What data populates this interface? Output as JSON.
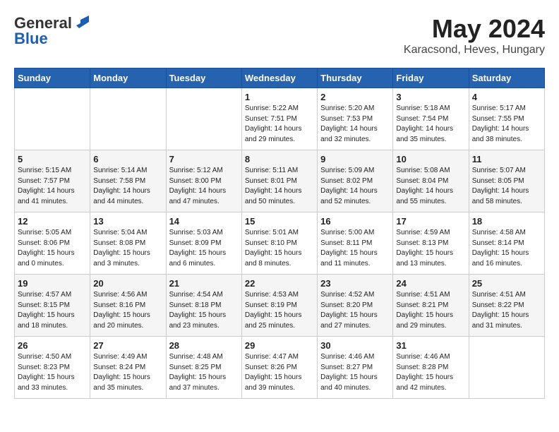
{
  "logo": {
    "line1": "General",
    "line2": "Blue"
  },
  "title": "May 2024",
  "subtitle": "Karacsond, Heves, Hungary",
  "days_of_week": [
    "Sunday",
    "Monday",
    "Tuesday",
    "Wednesday",
    "Thursday",
    "Friday",
    "Saturday"
  ],
  "weeks": [
    [
      {
        "day": "",
        "info": ""
      },
      {
        "day": "",
        "info": ""
      },
      {
        "day": "",
        "info": ""
      },
      {
        "day": "1",
        "info": "Sunrise: 5:22 AM\nSunset: 7:51 PM\nDaylight: 14 hours\nand 29 minutes."
      },
      {
        "day": "2",
        "info": "Sunrise: 5:20 AM\nSunset: 7:53 PM\nDaylight: 14 hours\nand 32 minutes."
      },
      {
        "day": "3",
        "info": "Sunrise: 5:18 AM\nSunset: 7:54 PM\nDaylight: 14 hours\nand 35 minutes."
      },
      {
        "day": "4",
        "info": "Sunrise: 5:17 AM\nSunset: 7:55 PM\nDaylight: 14 hours\nand 38 minutes."
      }
    ],
    [
      {
        "day": "5",
        "info": "Sunrise: 5:15 AM\nSunset: 7:57 PM\nDaylight: 14 hours\nand 41 minutes."
      },
      {
        "day": "6",
        "info": "Sunrise: 5:14 AM\nSunset: 7:58 PM\nDaylight: 14 hours\nand 44 minutes."
      },
      {
        "day": "7",
        "info": "Sunrise: 5:12 AM\nSunset: 8:00 PM\nDaylight: 14 hours\nand 47 minutes."
      },
      {
        "day": "8",
        "info": "Sunrise: 5:11 AM\nSunset: 8:01 PM\nDaylight: 14 hours\nand 50 minutes."
      },
      {
        "day": "9",
        "info": "Sunrise: 5:09 AM\nSunset: 8:02 PM\nDaylight: 14 hours\nand 52 minutes."
      },
      {
        "day": "10",
        "info": "Sunrise: 5:08 AM\nSunset: 8:04 PM\nDaylight: 14 hours\nand 55 minutes."
      },
      {
        "day": "11",
        "info": "Sunrise: 5:07 AM\nSunset: 8:05 PM\nDaylight: 14 hours\nand 58 minutes."
      }
    ],
    [
      {
        "day": "12",
        "info": "Sunrise: 5:05 AM\nSunset: 8:06 PM\nDaylight: 15 hours\nand 0 minutes."
      },
      {
        "day": "13",
        "info": "Sunrise: 5:04 AM\nSunset: 8:08 PM\nDaylight: 15 hours\nand 3 minutes."
      },
      {
        "day": "14",
        "info": "Sunrise: 5:03 AM\nSunset: 8:09 PM\nDaylight: 15 hours\nand 6 minutes."
      },
      {
        "day": "15",
        "info": "Sunrise: 5:01 AM\nSunset: 8:10 PM\nDaylight: 15 hours\nand 8 minutes."
      },
      {
        "day": "16",
        "info": "Sunrise: 5:00 AM\nSunset: 8:11 PM\nDaylight: 15 hours\nand 11 minutes."
      },
      {
        "day": "17",
        "info": "Sunrise: 4:59 AM\nSunset: 8:13 PM\nDaylight: 15 hours\nand 13 minutes."
      },
      {
        "day": "18",
        "info": "Sunrise: 4:58 AM\nSunset: 8:14 PM\nDaylight: 15 hours\nand 16 minutes."
      }
    ],
    [
      {
        "day": "19",
        "info": "Sunrise: 4:57 AM\nSunset: 8:15 PM\nDaylight: 15 hours\nand 18 minutes."
      },
      {
        "day": "20",
        "info": "Sunrise: 4:56 AM\nSunset: 8:16 PM\nDaylight: 15 hours\nand 20 minutes."
      },
      {
        "day": "21",
        "info": "Sunrise: 4:54 AM\nSunset: 8:18 PM\nDaylight: 15 hours\nand 23 minutes."
      },
      {
        "day": "22",
        "info": "Sunrise: 4:53 AM\nSunset: 8:19 PM\nDaylight: 15 hours\nand 25 minutes."
      },
      {
        "day": "23",
        "info": "Sunrise: 4:52 AM\nSunset: 8:20 PM\nDaylight: 15 hours\nand 27 minutes."
      },
      {
        "day": "24",
        "info": "Sunrise: 4:51 AM\nSunset: 8:21 PM\nDaylight: 15 hours\nand 29 minutes."
      },
      {
        "day": "25",
        "info": "Sunrise: 4:51 AM\nSunset: 8:22 PM\nDaylight: 15 hours\nand 31 minutes."
      }
    ],
    [
      {
        "day": "26",
        "info": "Sunrise: 4:50 AM\nSunset: 8:23 PM\nDaylight: 15 hours\nand 33 minutes."
      },
      {
        "day": "27",
        "info": "Sunrise: 4:49 AM\nSunset: 8:24 PM\nDaylight: 15 hours\nand 35 minutes."
      },
      {
        "day": "28",
        "info": "Sunrise: 4:48 AM\nSunset: 8:25 PM\nDaylight: 15 hours\nand 37 minutes."
      },
      {
        "day": "29",
        "info": "Sunrise: 4:47 AM\nSunset: 8:26 PM\nDaylight: 15 hours\nand 39 minutes."
      },
      {
        "day": "30",
        "info": "Sunrise: 4:46 AM\nSunset: 8:27 PM\nDaylight: 15 hours\nand 40 minutes."
      },
      {
        "day": "31",
        "info": "Sunrise: 4:46 AM\nSunset: 8:28 PM\nDaylight: 15 hours\nand 42 minutes."
      },
      {
        "day": "",
        "info": ""
      }
    ]
  ]
}
